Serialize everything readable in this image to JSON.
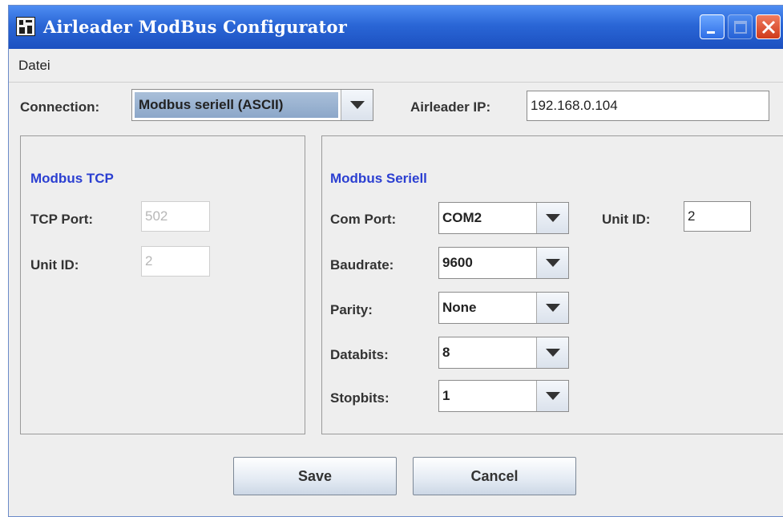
{
  "window": {
    "title": "Airleader ModBus Configurator"
  },
  "menu": {
    "items": [
      "Datei"
    ]
  },
  "connection": {
    "label": "Connection:",
    "selected": "Modbus seriell (ASCII)",
    "ip_label": "Airleader IP:",
    "ip_value": "192.168.0.104"
  },
  "tcp": {
    "title": "Modbus TCP",
    "port_label": "TCP Port:",
    "port_value": "502",
    "unit_label": "Unit ID:",
    "unit_value": "2"
  },
  "serial": {
    "title": "Modbus Seriell",
    "com_label": "Com Port:",
    "com_value": "COM2",
    "unit_label": "Unit ID:",
    "unit_value": "2",
    "baud_label": "Baudrate:",
    "baud_value": "9600",
    "parity_label": "Parity:",
    "parity_value": "None",
    "databits_label": "Databits:",
    "databits_value": "8",
    "stopbits_label": "Stopbits:",
    "stopbits_value": "1"
  },
  "buttons": {
    "save": "Save",
    "cancel": "Cancel"
  },
  "colors": {
    "titlebar": "#2a66d6",
    "panel_title": "#2b3fd1",
    "close_button": "#cf3a1a"
  }
}
